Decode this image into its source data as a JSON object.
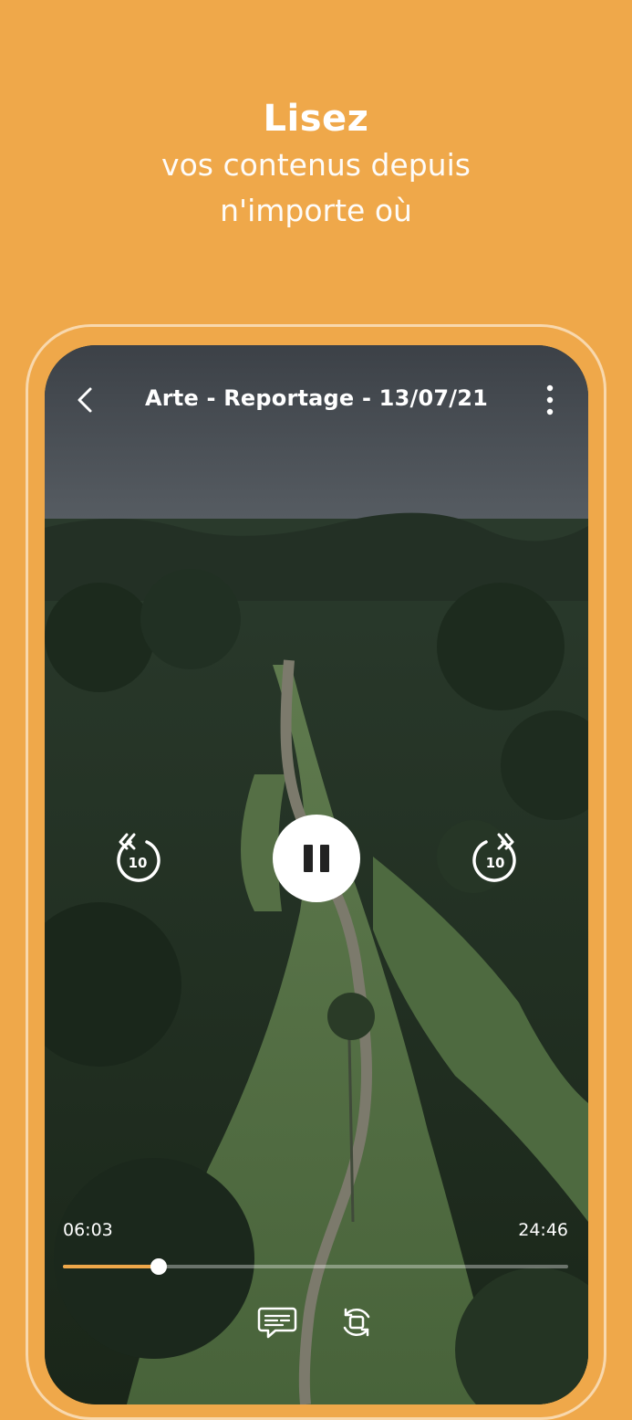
{
  "promo": {
    "title": "Lisez",
    "subtitle_line1": "vos contenus depuis",
    "subtitle_line2": "n'importe où"
  },
  "player": {
    "title": "Arte - Reportage - 13/07/21",
    "elapsed": "06:03",
    "total": "24:46",
    "progress_fraction": 0.19,
    "rewind_label": "10",
    "forward_label": "10",
    "state": "playing"
  },
  "icons": {
    "back": "chevron-left-icon",
    "more": "more-vertical-icon",
    "rewind": "rewind-10-icon",
    "pause": "pause-icon",
    "forward": "forward-10-icon",
    "subtitles": "subtitles-icon",
    "rotate": "screen-rotate-icon"
  },
  "colors": {
    "background": "#EFA84A",
    "accent": "#EFA84A",
    "text": "#FFFFFF"
  }
}
